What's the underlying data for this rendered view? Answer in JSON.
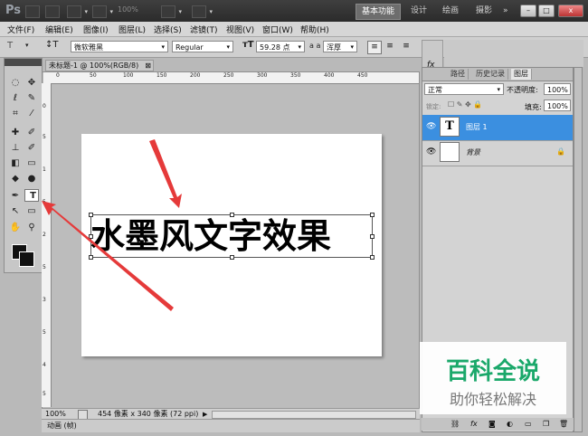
{
  "app": {
    "logo": "Ps",
    "zoom_display": "100%",
    "workspaces": [
      "基本功能",
      "设计",
      "绘画",
      "摄影"
    ],
    "more": "»",
    "window_buttons": [
      "–",
      "□",
      "x"
    ]
  },
  "menubar": {
    "items": [
      "文件(F)",
      "编辑(E)",
      "图像(I)",
      "图层(L)",
      "选择(S)",
      "滤镜(T)",
      "视图(V)",
      "窗口(W)",
      "帮助(H)"
    ]
  },
  "options": {
    "tool_icon": "T",
    "font_family": "微软雅黑",
    "font_style": "Regular",
    "font_size": "59.28 点",
    "aa_label": "a a",
    "aa_value": "浑厚"
  },
  "document": {
    "tab_title": "未标题-1 @ 100%(RGB/8)",
    "canvas_text": "水墨风文字效果",
    "ruler_top": [
      "0",
      "50",
      "100",
      "150",
      "200",
      "250",
      "300",
      "350",
      "400",
      "450"
    ],
    "ruler_left": [
      "0",
      "5",
      "1",
      "5",
      "2",
      "5",
      "3",
      "5",
      "4",
      "5"
    ],
    "status_zoom": "100%",
    "status_info": "454 像素 x 340 像素 (72 ppi)",
    "anim_label": "动画 (帧)"
  },
  "panels": {
    "tabs": [
      "路径",
      "历史记录",
      "图层"
    ],
    "active_tab": "图层",
    "blend_mode": "正常",
    "opacity_label": "不透明度:",
    "opacity_value": "100%",
    "lock_label": "锁定:",
    "fill_label": "填充:",
    "fill_value": "100%",
    "layers": [
      {
        "name": "图层 1",
        "type": "text",
        "thumb": "T",
        "selected": true
      },
      {
        "name": "背景",
        "type": "background",
        "thumb": "",
        "selected": false
      }
    ]
  },
  "watermark": {
    "line1": "百科全说",
    "line2": "助你轻松解决"
  },
  "colors": {
    "accent_selected_layer": "#3b8fe0",
    "arrow_red": "#e53a3a",
    "watermark_green": "#1aa86a"
  }
}
